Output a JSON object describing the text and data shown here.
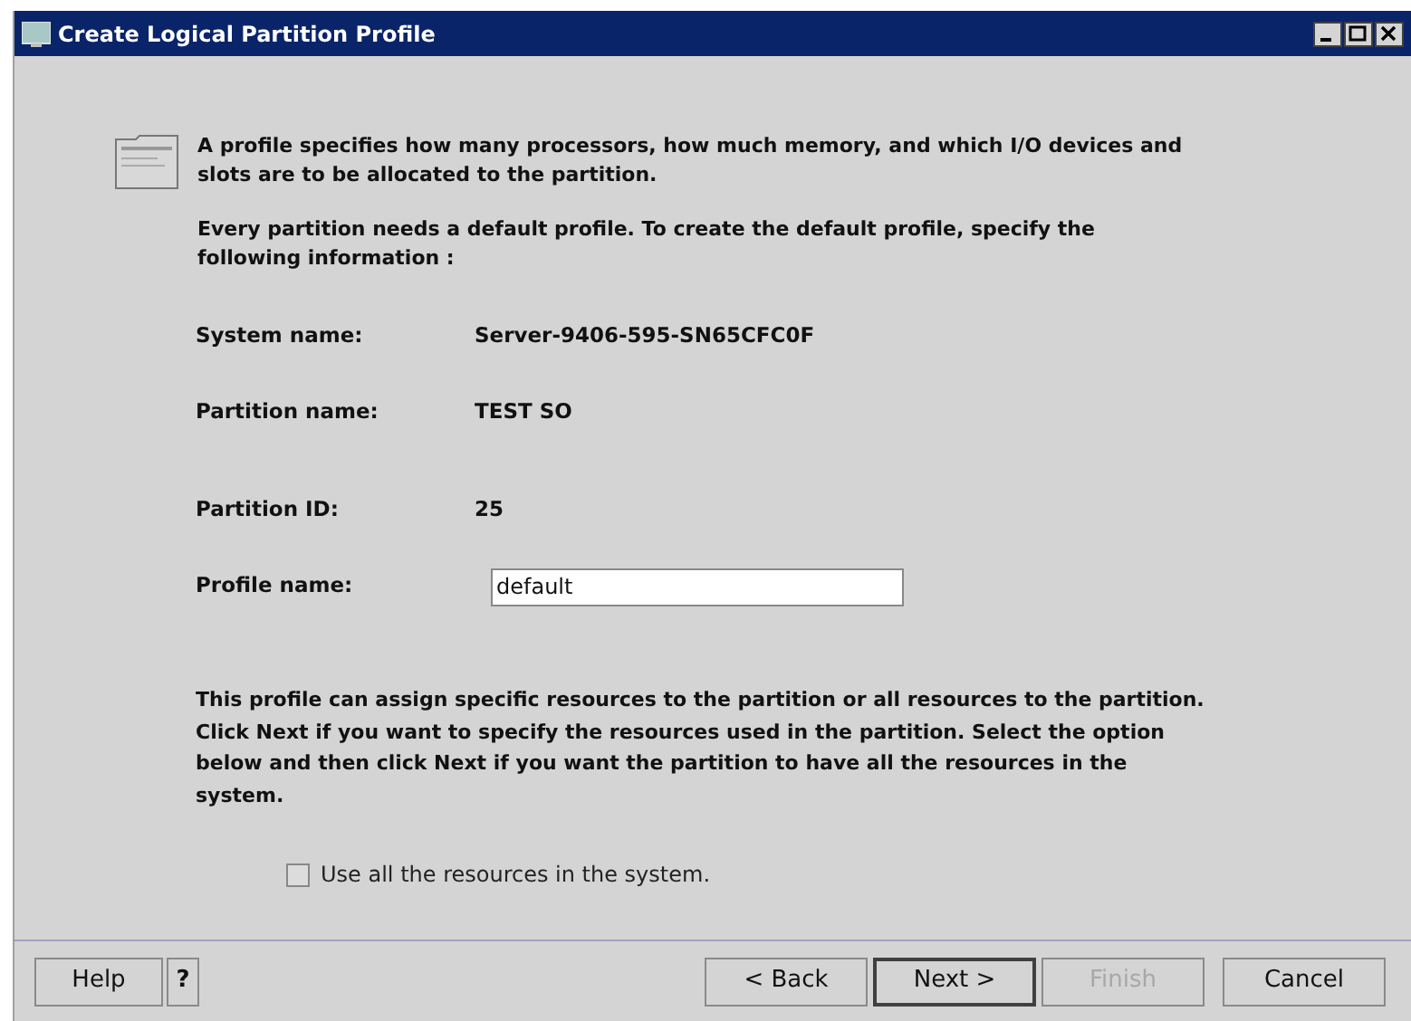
{
  "window": {
    "title": "Create Logical Partition Profile"
  },
  "intro": "A profile specifies how many processors, how much memory, and which I/O devices and slots are to be allocated to the partition.",
  "instruction": "Every partition needs a default profile.  To create the default profile, specify the following information :",
  "fields": [
    {
      "kind": "text",
      "label": "System name:",
      "value": "Server-9406-595-SN65CFC0F"
    },
    {
      "kind": "text",
      "label": "Partition name:",
      "value": "TEST SO"
    },
    {
      "kind": "text",
      "label": "Partition ID:",
      "value": "25"
    },
    {
      "kind": "input",
      "label": "Profile name:",
      "value": "default"
    }
  ],
  "explanation": "This profile can assign specific resources to the partition or all resources to the partition.  Click Next if you want to specify the resources used in the partition.  Select the option below and then click Next if you want the partition to have all the resources in the system.",
  "option": {
    "label": "Use all the resources in the system.",
    "checked": false
  },
  "left_buttons": [
    "Help",
    "?"
  ],
  "right_buttons": [
    {
      "label": "< Back",
      "disabled": false,
      "default": false
    },
    {
      "label": "Next >",
      "disabled": false,
      "default": true
    },
    {
      "label": "Finish",
      "disabled": true,
      "default": false
    },
    {
      "label": "Cancel",
      "disabled": false,
      "default": false
    }
  ]
}
